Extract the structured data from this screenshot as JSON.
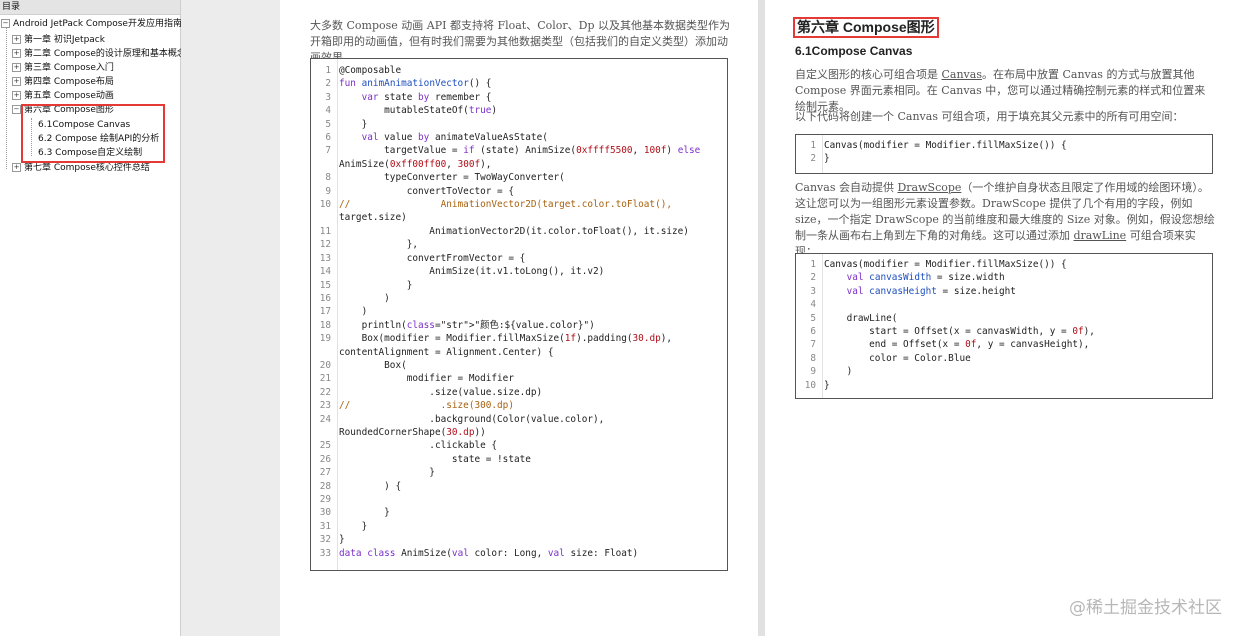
{
  "toc": {
    "header": "目录",
    "root": "Android JetPack Compose开发应用指南",
    "chapters": [
      "第一章 初识Jetpack",
      "第二章 Compose的设计原理和基本概念",
      "第三章 Compose入门",
      "第四章 Compose布局",
      "第五章 Compose动画",
      "第六章 Compose图形",
      "第七章 Compose核心控件总结"
    ],
    "sub": [
      "6.1Compose Canvas",
      "6.2 Compose 绘制API的分析",
      "6.3 Compose自定义绘制"
    ],
    "toggle_expanded": "−",
    "toggle_collapsed": "+"
  },
  "left_page": {
    "intro": "大多数 Compose 动画 API 都支持将 Float、Color、Dp 以及其他基本数据类型作为开箱即用的动画值，但有时我们需要为其他数据类型（包括我们的自定义类型）添加动画效果。",
    "code": [
      {
        "n": "1",
        "t": "@Composable"
      },
      {
        "n": "2",
        "t": "fun animAnimationVector() {"
      },
      {
        "n": "3",
        "t": "    var state by remember {"
      },
      {
        "n": "4",
        "t": "        mutableStateOf(true)"
      },
      {
        "n": "5",
        "t": "    }"
      },
      {
        "n": "6",
        "t": "    val value by animateValueAsState("
      },
      {
        "n": "7",
        "t": "        targetValue = if (state) AnimSize(0xffff5500, 100f) else"
      },
      {
        "n": "",
        "t": "AnimSize(0xff00ff00, 300f),"
      },
      {
        "n": "8",
        "t": "        typeConverter = TwoWayConverter("
      },
      {
        "n": "9",
        "t": "            convertToVector = {"
      },
      {
        "n": "10",
        "t": "//                AnimationVector2D(target.color.toFloat(),"
      },
      {
        "n": "",
        "t": "target.size)"
      },
      {
        "n": "11",
        "t": "                AnimationVector2D(it.color.toFloat(), it.size)"
      },
      {
        "n": "12",
        "t": "            },"
      },
      {
        "n": "13",
        "t": "            convertFromVector = {"
      },
      {
        "n": "14",
        "t": "                AnimSize(it.v1.toLong(), it.v2)"
      },
      {
        "n": "15",
        "t": "            }"
      },
      {
        "n": "16",
        "t": "        )"
      },
      {
        "n": "17",
        "t": "    )"
      },
      {
        "n": "18",
        "t": "    println(\"颜色:${value.color}\")"
      },
      {
        "n": "19",
        "t": "    Box(modifier = Modifier.fillMaxSize(1f).padding(30.dp),"
      },
      {
        "n": "",
        "t": "contentAlignment = Alignment.Center) {"
      },
      {
        "n": "20",
        "t": "        Box("
      },
      {
        "n": "21",
        "t": "            modifier = Modifier"
      },
      {
        "n": "22",
        "t": "                .size(value.size.dp)"
      },
      {
        "n": "23",
        "t": "//                .size(300.dp)"
      },
      {
        "n": "24",
        "t": "                .background(Color(value.color),"
      },
      {
        "n": "",
        "t": "RoundedCornerShape(30.dp))"
      },
      {
        "n": "25",
        "t": "                .clickable {"
      },
      {
        "n": "26",
        "t": "                    state = !state"
      },
      {
        "n": "27",
        "t": "                }"
      },
      {
        "n": "28",
        "t": "        ) {"
      },
      {
        "n": "29",
        "t": ""
      },
      {
        "n": "30",
        "t": "        }"
      },
      {
        "n": "31",
        "t": "    }"
      },
      {
        "n": "32",
        "t": "}"
      },
      {
        "n": "33",
        "t": "data class AnimSize(val color: Long, val size: Float)"
      }
    ]
  },
  "right_page": {
    "chapter_title": "第六章 Compose图形",
    "section_title": "6.1Compose Canvas",
    "p1_a": "自定义图形的核心可组合项是 ",
    "p1_link": "Canvas",
    "p1_b": "。在布局中放置 Canvas 的方式与放置其他 Compose 界面元素相同。在 Canvas 中，您可以通过精确控制元素的样式和位置来绘制元素。",
    "p2": "以下代码将创建一个 Canvas 可组合项，用于填充其父元素中的所有可用空间：",
    "code1": [
      {
        "n": "1",
        "t": "Canvas(modifier = Modifier.fillMaxSize()) {"
      },
      {
        "n": "2",
        "t": "}"
      }
    ],
    "p3_a": "Canvas 会自动提供 ",
    "p3_link1": "DrawScope",
    "p3_b": "（一个维护自身状态且限定了作用域的绘图环境）。这让您可以为一组图形元素设置参数。DrawScope 提供了几个有用的字段，例如 size，一个指定 DrawScope 的当前维度和最大维度的 Size 对象。例如，假设您想绘制一条从画布右上角到左下角的对角线。这可以通过添加 ",
    "p3_link2": "drawLine",
    "p3_c": " 可组合项来实现：",
    "code2": [
      {
        "n": "1",
        "t": "Canvas(modifier = Modifier.fillMaxSize()) {"
      },
      {
        "n": "2",
        "t": "    val canvasWidth = size.width"
      },
      {
        "n": "3",
        "t": "    val canvasHeight = size.height"
      },
      {
        "n": "4",
        "t": ""
      },
      {
        "n": "5",
        "t": "    drawLine("
      },
      {
        "n": "6",
        "t": "        start = Offset(x = canvasWidth, y = 0f),"
      },
      {
        "n": "7",
        "t": "        end = Offset(x = 0f, y = canvasHeight),"
      },
      {
        "n": "8",
        "t": "        color = Color.Blue"
      },
      {
        "n": "9",
        "t": "    )"
      },
      {
        "n": "10",
        "t": "}"
      }
    ]
  },
  "watermark": "@稀土掘金技术社区",
  "colors": {
    "highlight": "#e53935",
    "keyword": "#7b30c9",
    "function": "#1f4fbf",
    "string": "#b0101a",
    "comment": "#a8620f"
  }
}
